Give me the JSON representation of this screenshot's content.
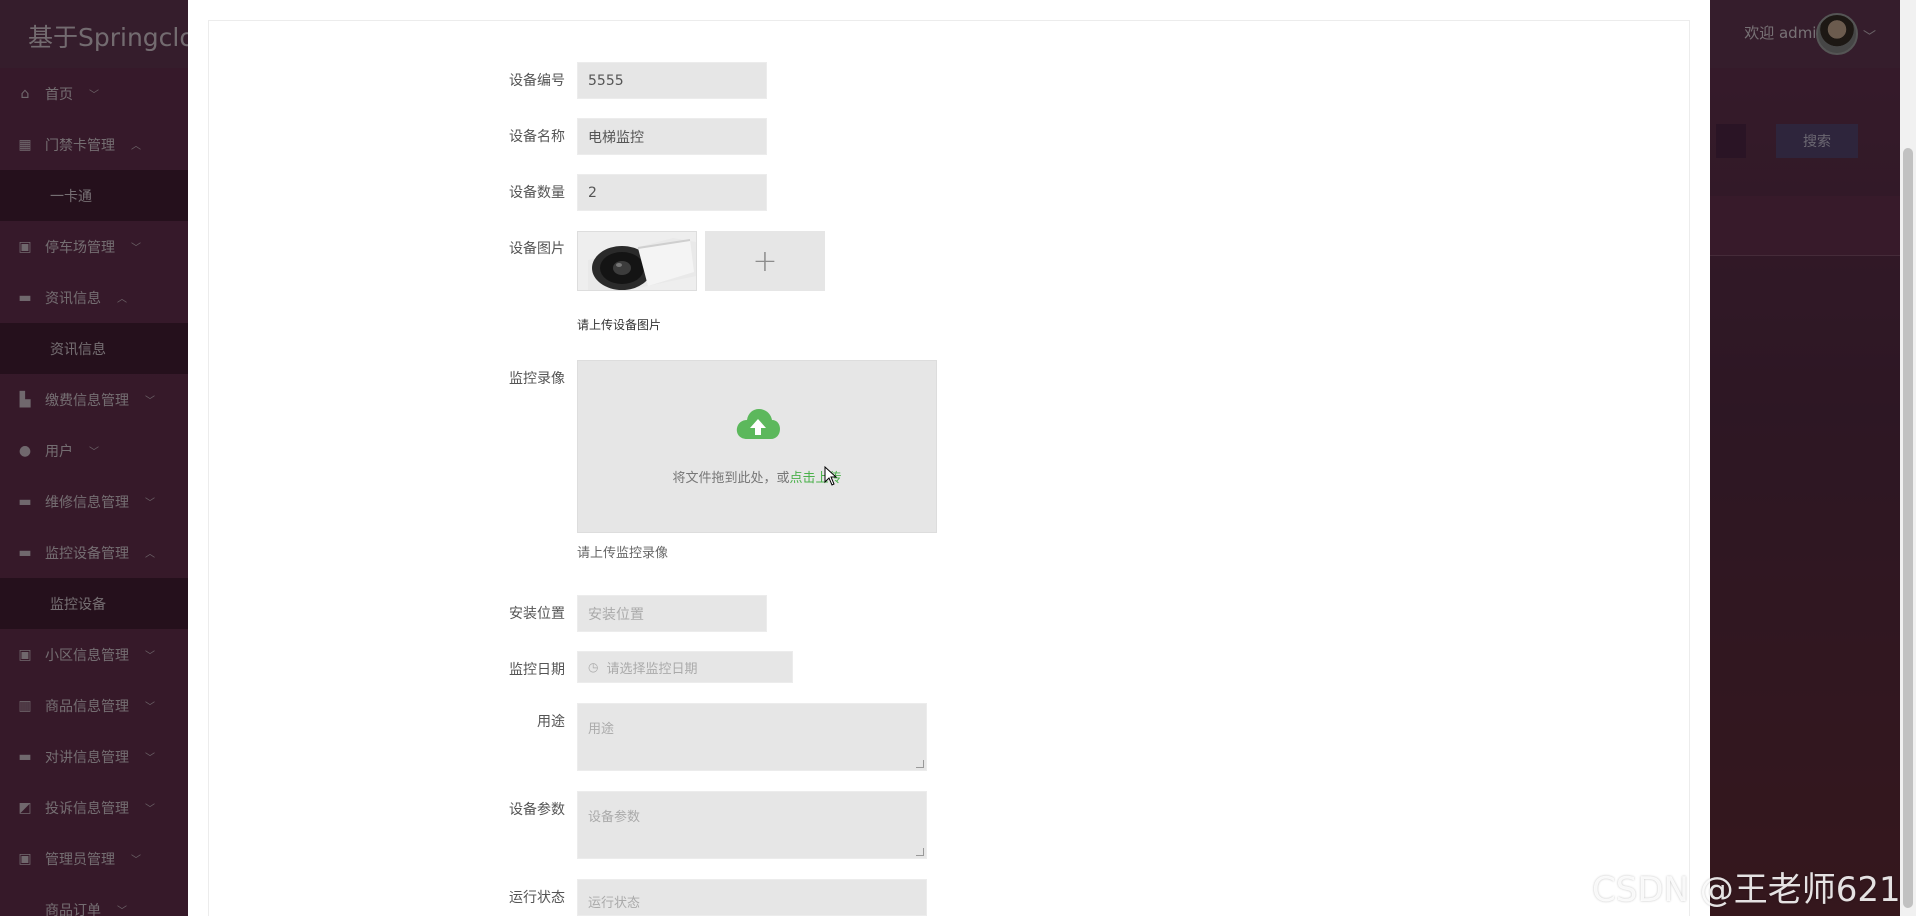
{
  "app": {
    "title": "基于Springclou",
    "welcome": "欢迎 admin",
    "search_button": "搜索"
  },
  "sidebar": {
    "items": [
      {
        "label": "首页",
        "icon": "home-icon",
        "glyph": "⌂",
        "caret": "﹀"
      },
      {
        "label": "门禁卡管理",
        "icon": "grid-icon",
        "glyph": "▦",
        "caret": "︿"
      },
      {
        "label": "一卡通",
        "sub": true
      },
      {
        "label": "停车场管理",
        "icon": "dashboard-icon",
        "glyph": "▣",
        "caret": "﹀"
      },
      {
        "label": "资讯信息",
        "icon": "list-icon",
        "glyph": "▬",
        "caret": "︿"
      },
      {
        "label": "资讯信息",
        "sub": true
      },
      {
        "label": "缴费信息管理",
        "icon": "chart-icon",
        "glyph": "▙",
        "caret": "﹀"
      },
      {
        "label": "用户",
        "icon": "user-icon",
        "glyph": "●",
        "caret": "﹀"
      },
      {
        "label": "维修信息管理",
        "icon": "list-icon",
        "glyph": "▬",
        "caret": "﹀"
      },
      {
        "label": "监控设备管理",
        "icon": "list-icon",
        "glyph": "▬",
        "caret": "︿"
      },
      {
        "label": "监控设备",
        "sub": true
      },
      {
        "label": "小区信息管理",
        "icon": "dashboard-icon",
        "glyph": "▣",
        "caret": "﹀"
      },
      {
        "label": "商品信息管理",
        "icon": "columns-icon",
        "glyph": "▥",
        "caret": "﹀"
      },
      {
        "label": "对讲信息管理",
        "icon": "list-icon",
        "glyph": "▬",
        "caret": "﹀"
      },
      {
        "label": "投诉信息管理",
        "icon": "chart-icon",
        "glyph": "◩",
        "caret": "﹀"
      },
      {
        "label": "管理员管理",
        "icon": "dashboard-icon",
        "glyph": "▣",
        "caret": "﹀"
      },
      {
        "label": "商品订单",
        "icon": "",
        "glyph": "",
        "caret": "﹀"
      }
    ]
  },
  "form": {
    "device_no": {
      "label": "设备编号",
      "value": "5555"
    },
    "device_name": {
      "label": "设备名称",
      "value": "电梯监控"
    },
    "device_count": {
      "label": "设备数量",
      "value": "2"
    },
    "device_image": {
      "label": "设备图片",
      "hint": "请上传设备图片",
      "plus": "+"
    },
    "video": {
      "label": "监控录像",
      "drag_text": "将文件拖到此处，或",
      "link_text": "点击上传",
      "hint": "请上传监控录像"
    },
    "location": {
      "label": "安装位置",
      "placeholder": "安装位置"
    },
    "monitor_date": {
      "label": "监控日期",
      "placeholder": "请选择监控日期"
    },
    "purpose": {
      "label": "用途",
      "placeholder": "用途"
    },
    "params": {
      "label": "设备参数",
      "placeholder": "设备参数"
    },
    "status": {
      "label": "运行状态",
      "placeholder": "运行状态"
    }
  },
  "watermark": "CSDN @王老师621",
  "colors": {
    "accent_green": "#4ab04a",
    "sidebar_bg": "#6e3454",
    "submenu_bg": "#4a2039"
  }
}
